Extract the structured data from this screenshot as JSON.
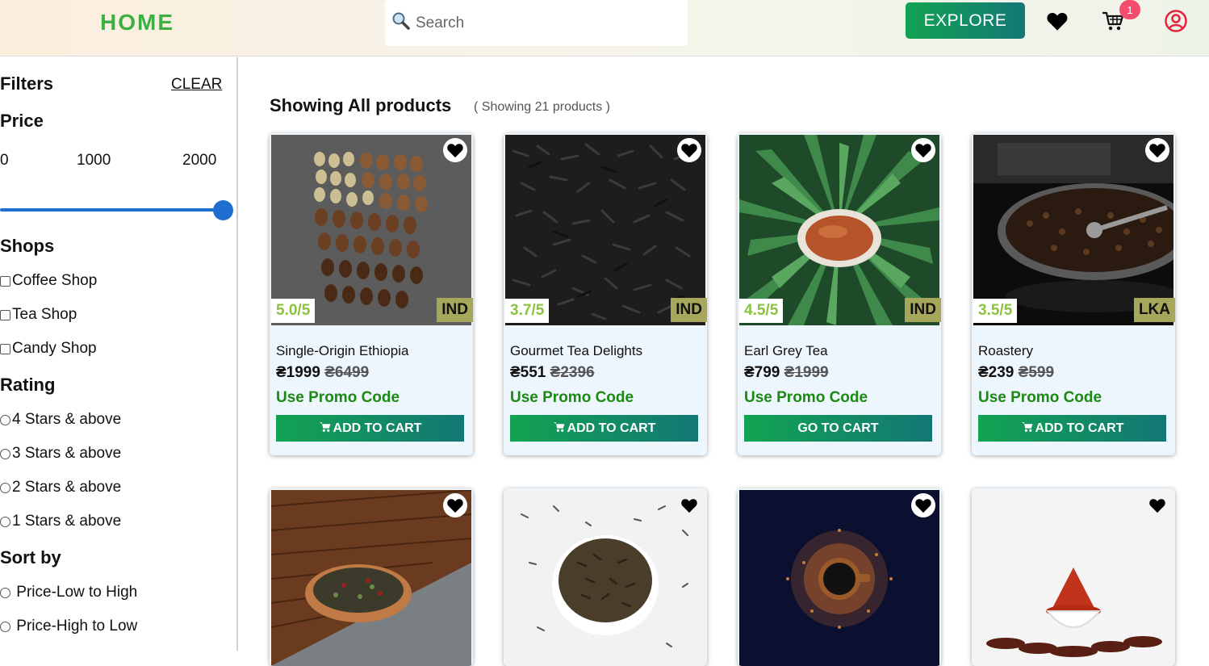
{
  "header": {
    "home_label": "HOME",
    "search_placeholder": "Search",
    "explore_label": "EXPLORE",
    "cart_count": "1"
  },
  "filters": {
    "title": "Filters",
    "clear_label": "CLEAR",
    "price_title": "Price",
    "price_labels": [
      "0",
      "1000",
      "2000"
    ],
    "price_value": 2000,
    "shops_title": "Shops",
    "shops": [
      "Coffee Shop",
      "Tea Shop",
      "Candy Shop"
    ],
    "rating_title": "Rating",
    "ratings": [
      "4 Stars & above",
      "3 Stars & above",
      "2 Stars & above",
      "1 Stars & above"
    ],
    "sort_title": "Sort by",
    "sort_options": [
      " Price-Low to High",
      " Price-High to Low"
    ]
  },
  "main": {
    "title": "Showing All products",
    "subtitle": "( Showing 21 products )"
  },
  "products": [
    {
      "rating": "5.0/5",
      "country": "IND",
      "name": "Single-Origin Ethiopia",
      "price": "₴1999",
      "old_price": "₴6499",
      "promo": "Use Promo Code",
      "button": "ADD TO CART",
      "button_icon": true
    },
    {
      "rating": "3.7/5",
      "country": "IND",
      "name": "Gourmet Tea Delights",
      "price": "₴551",
      "old_price": "₴2396",
      "promo": "Use Promo Code",
      "button": "ADD TO CART",
      "button_icon": true
    },
    {
      "rating": "4.5/5",
      "country": "IND",
      "name": "Earl Grey Tea",
      "price": "₴799",
      "old_price": "₴1999",
      "promo": "Use Promo Code",
      "button": "GO TO CART",
      "button_icon": false
    },
    {
      "rating": "3.5/5",
      "country": "LKA",
      "name": "Roastery",
      "price": "₴239",
      "old_price": "₴599",
      "promo": "Use Promo Code",
      "button": "ADD TO CART",
      "button_icon": true
    }
  ],
  "colors": {
    "accent_green": "#12a352",
    "accent_teal": "#137775",
    "rating_green": "#8ac43f",
    "promo_green": "#1a8a13",
    "badge_pink": "#f44c6c",
    "slider_blue": "#1f6fd1"
  }
}
